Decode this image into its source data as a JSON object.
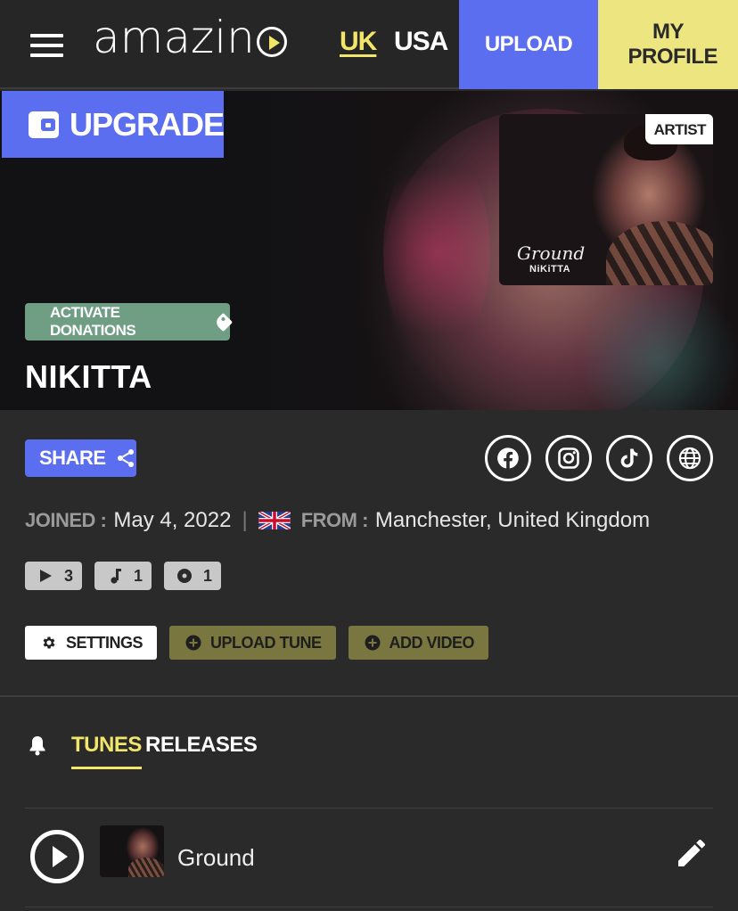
{
  "nav": {
    "logo_text": "amazin",
    "countries": [
      "UK",
      "USA"
    ],
    "active_country": "UK",
    "upload_label": "UPLOAD",
    "profile_label": "MY PROFILE"
  },
  "hero": {
    "upgrade_label": "UPGRADE",
    "artwork": {
      "badge": "ARTIST",
      "title": "Ground",
      "artist": "NiKiTTA"
    },
    "donate_label": "ACTIVATE DONATIONS",
    "artist_name": "NIKITTA"
  },
  "profile": {
    "share_label": "SHARE",
    "social": [
      "facebook-icon",
      "instagram-icon",
      "tiktok-icon",
      "website-icon"
    ],
    "joined_label": "JOINED :",
    "joined_value": "May 4, 2022",
    "separator": "|",
    "from_label": "FROM :",
    "from_value": "Manchester, United Kingdom",
    "stats": {
      "plays": "3",
      "tunes": "1",
      "releases": "1"
    },
    "actions": {
      "settings": "SETTINGS",
      "upload_tune": "UPLOAD TUNE",
      "add_video": "ADD VIDEO"
    }
  },
  "tabs": {
    "items": [
      "TUNES",
      "RELEASES"
    ],
    "active": "TUNES"
  },
  "tracks": [
    {
      "title": "Ground"
    }
  ],
  "colors": {
    "accent_blue": "#5b6ef0",
    "accent_yellow": "#f1e66a",
    "donate_green": "#6f9e84",
    "action_olive": "#7a7640",
    "background": "#2a2a2a"
  }
}
